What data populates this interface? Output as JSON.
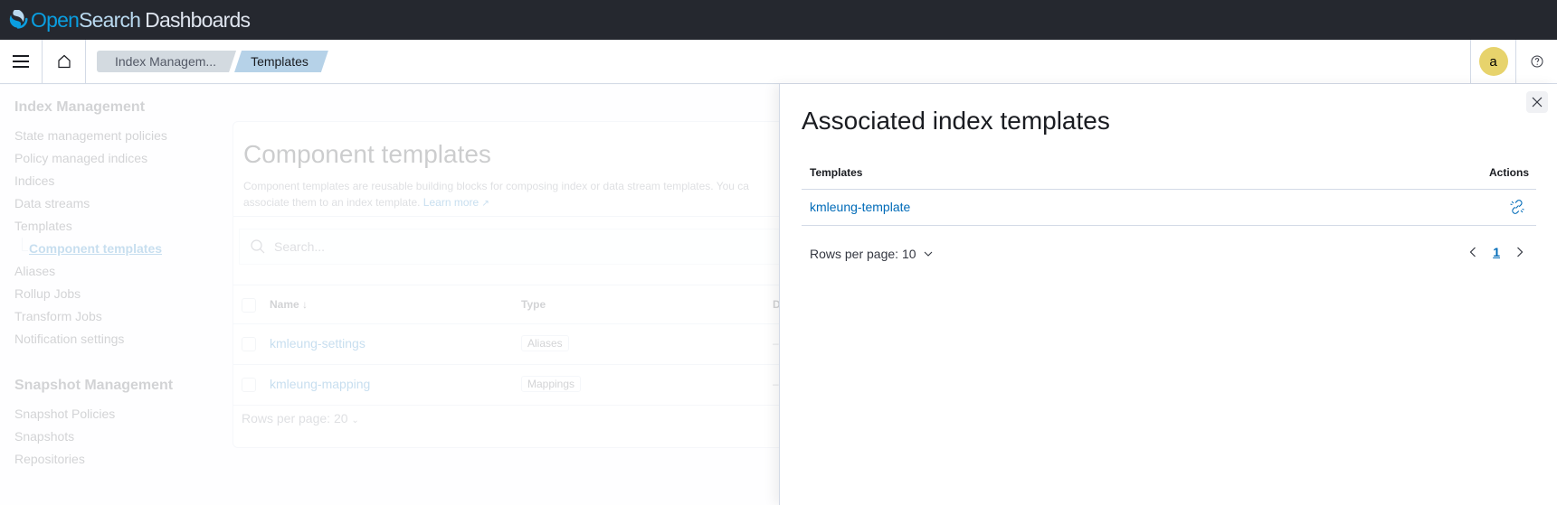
{
  "header": {
    "brand_open": "Open",
    "brand_search": "Search",
    "brand_dashboards": "Dashboards",
    "menu_icon": "hamburger-menu-icon",
    "home_icon": "home-icon",
    "breadcrumbs": [
      {
        "label": "Index Managem..."
      },
      {
        "label": "Templates"
      }
    ],
    "avatar_initial": "a",
    "help_icon": "help-icon"
  },
  "sidebar": {
    "sections": [
      {
        "title": "Index Management",
        "items": [
          {
            "label": "State management policies"
          },
          {
            "label": "Policy managed indices"
          },
          {
            "label": "Indices"
          },
          {
            "label": "Data streams"
          },
          {
            "label": "Templates"
          },
          {
            "label": "Component templates",
            "selected": true
          },
          {
            "label": "Aliases"
          },
          {
            "label": "Rollup Jobs"
          },
          {
            "label": "Transform Jobs"
          },
          {
            "label": "Notification settings"
          }
        ]
      },
      {
        "title": "Snapshot Management",
        "items": [
          {
            "label": "Snapshot Policies"
          },
          {
            "label": "Snapshots"
          },
          {
            "label": "Repositories"
          }
        ]
      }
    ]
  },
  "main": {
    "title": "Component templates",
    "description": "Component templates are reusable building blocks for composing index or data stream templates. You ca",
    "description_line2": "associate them to an index template.",
    "learn_more": "Learn more",
    "search_placeholder": "Search...",
    "columns": [
      "Name",
      "Type",
      "D"
    ],
    "rows": [
      {
        "name": "kmleung-settings",
        "type": "Aliases",
        "extra": "–"
      },
      {
        "name": "kmleung-mapping",
        "type": "Mappings",
        "extra": "–"
      }
    ],
    "rows_per_page": "Rows per page: 20"
  },
  "flyout": {
    "title": "Associated index templates",
    "columns": {
      "templates": "Templates",
      "actions": "Actions"
    },
    "rows": [
      {
        "template": "kmleung-template",
        "action_icon": "unlink-icon"
      }
    ],
    "rows_per_page": "Rows per page: 10",
    "current_page": "1"
  },
  "colors": {
    "topbar": "#25282f",
    "link": "#006bb8",
    "avatar": "#e7d36c",
    "breadcrumb_active": "#b6d2e8"
  }
}
